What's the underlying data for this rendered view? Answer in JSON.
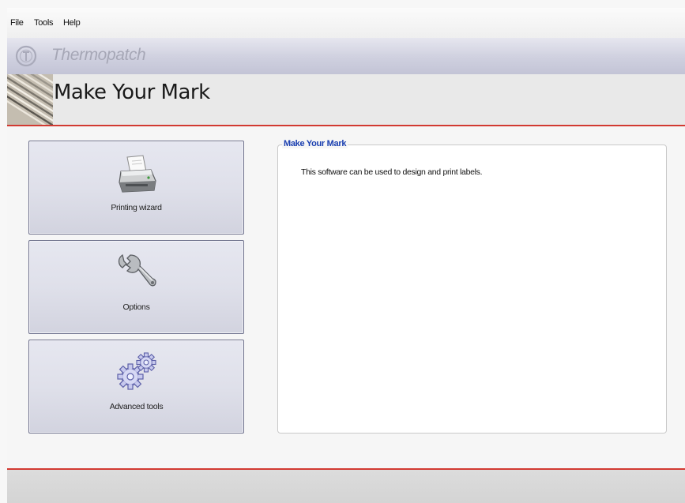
{
  "menubar": {
    "items": [
      "File",
      "Tools",
      "Help"
    ]
  },
  "brand": {
    "name": "Thermopatch"
  },
  "header": {
    "title": "Make Your Mark"
  },
  "nav": {
    "printing_wizard": "Printing wizard",
    "options": "Options",
    "advanced_tools": "Advanced tools"
  },
  "info_panel": {
    "title": "Make Your Mark",
    "description": "This software can be used to design and print labels."
  },
  "colors": {
    "accent_line": "#d23a32",
    "group_title": "#1a3fb0",
    "button_border": "#6f728d"
  },
  "icons": {
    "printing_wizard": "printer-icon",
    "options": "wrench-icon",
    "advanced_tools": "gears-icon"
  }
}
